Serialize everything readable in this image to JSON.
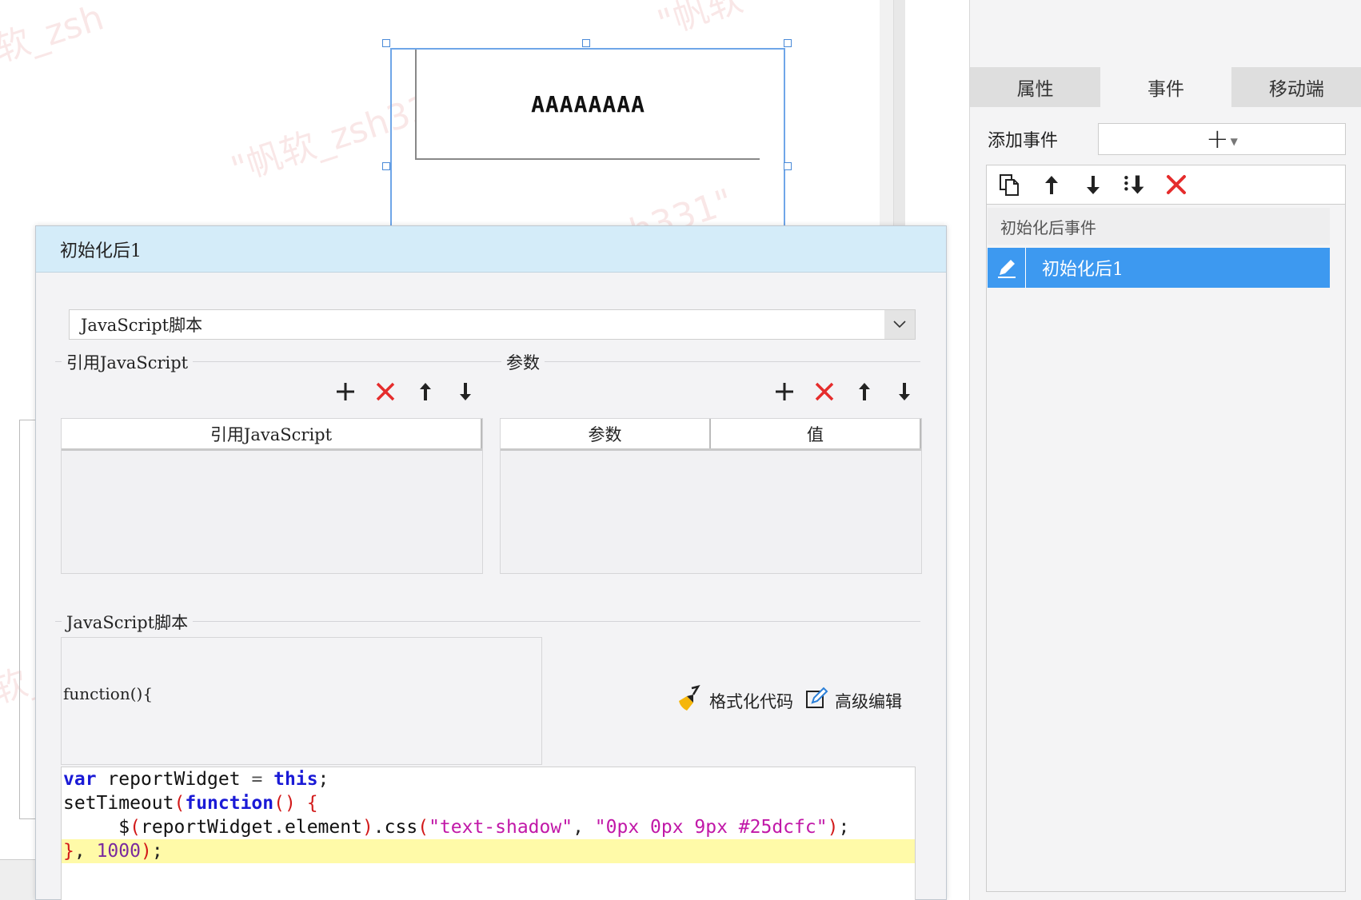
{
  "canvas": {
    "watermarks": [
      "软_zsh",
      "\"帆软",
      "\"帆软_zsh331\"",
      "h331\"",
      "软_"
    ],
    "widget_text": "AAAAAAAA"
  },
  "right_panel": {
    "tabs": [
      {
        "label": "属性",
        "active": false
      },
      {
        "label": "事件",
        "active": true
      },
      {
        "label": "移动端",
        "active": false
      }
    ],
    "add_event_label": "添加事件",
    "add_event_icon": "plus-icon",
    "toolbar_icons": [
      "copy-icon",
      "arrow-up-icon",
      "arrow-down-icon",
      "sort-icon",
      "delete-icon"
    ],
    "event_group": "初始化后事件",
    "events": [
      {
        "label": "初始化后1",
        "selected": true,
        "icon": "edit-pen-icon"
      }
    ]
  },
  "dialog": {
    "title": "初始化后1",
    "type_select": "JavaScript脚本",
    "ref_section": {
      "legend": "引用JavaScript",
      "columns": [
        "引用JavaScript"
      ],
      "rows": []
    },
    "param_section": {
      "legend": "参数",
      "columns": [
        "参数",
        "值"
      ],
      "rows": []
    },
    "script_section": {
      "legend": "JavaScript脚本",
      "fn_signature": "function(){",
      "format_code_label": "格式化代码",
      "advanced_edit_label": "高级编辑"
    },
    "code_lines": [
      "var reportWidget = this;",
      "setTimeout(function() {",
      "     $(reportWidget.element).css(\"text-shadow\", \"0px 0px 9px #25dcfc\");",
      "}, 1000);"
    ],
    "highlighted_line": 4
  },
  "colors": {
    "selection_blue": "#3d99f0",
    "dialog_title_bg": "#d4ecf9",
    "delete_red": "#e52c2c",
    "code_highlight": "#fffaa8"
  }
}
